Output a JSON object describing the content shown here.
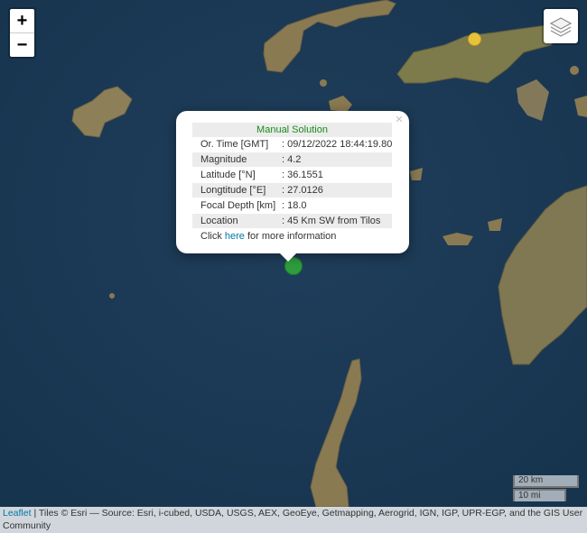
{
  "map": {
    "zoom_in_label": "+",
    "zoom_out_label": "−",
    "layers_icon": "layers-icon",
    "marker_colors": {
      "event": "#2e9d3e",
      "other": "#e8c33a"
    }
  },
  "popup": {
    "close_label": "×",
    "title": "Manual Solution",
    "rows": [
      {
        "label": "Or. Time [GMT]",
        "value": ": 09/12/2022 18:44:19.80"
      },
      {
        "label": "Magnitude",
        "value": ": 4.2"
      },
      {
        "label": "Latitude [°N]",
        "value": ": 36.1551"
      },
      {
        "label": "Longtitude [°E]",
        "value": ": 27.0126"
      },
      {
        "label": "Focal Depth [km]",
        "value": ": 18.0"
      },
      {
        "label": "Location",
        "value": ": 45 Km SW from Tilos"
      }
    ],
    "footer_prefix": "Click ",
    "footer_link": "here",
    "footer_suffix": " for more information"
  },
  "scale": {
    "metric": "20 km",
    "imperial": "10 mi"
  },
  "attribution": {
    "leaflet_link": "Leaflet",
    "text": " | Tiles © Esri — Source: Esri, i-cubed, USDA, USGS, AEX, GeoEye, Getmapping, Aerogrid, IGN, IGP, UPR-EGP, and the GIS User Community"
  }
}
